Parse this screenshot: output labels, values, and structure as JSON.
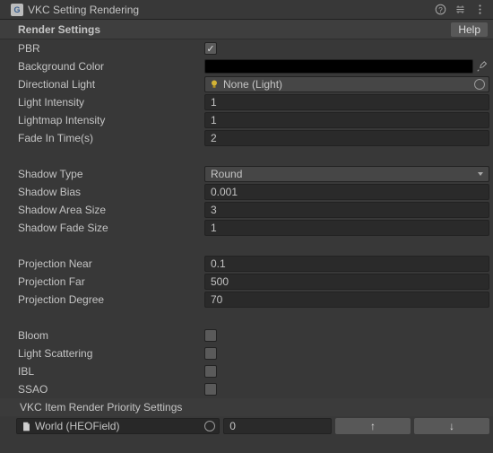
{
  "titlebar": {
    "title": "VKC Setting Rendering"
  },
  "header": {
    "title": "Render Settings",
    "help_label": "Help"
  },
  "fields": {
    "pbr": "PBR",
    "background_color": "Background Color",
    "directional_light": "Directional Light",
    "directional_light_value": "None (Light)",
    "light_intensity": "Light Intensity",
    "light_intensity_value": "1",
    "lightmap_intensity": "Lightmap Intensity",
    "lightmap_intensity_value": "1",
    "fade_in_time": "Fade In Time(s)",
    "fade_in_time_value": "2",
    "shadow_type": "Shadow Type",
    "shadow_type_value": "Round",
    "shadow_bias": "Shadow Bias",
    "shadow_bias_value": "0.001",
    "shadow_area_size": "Shadow Area Size",
    "shadow_area_size_value": "3",
    "shadow_fade_size": "Shadow Fade Size",
    "shadow_fade_size_value": "1",
    "projection_near": "Projection Near",
    "projection_near_value": "0.1",
    "projection_far": "Projection Far",
    "projection_far_value": "500",
    "projection_degree": "Projection Degree",
    "projection_degree_value": "70",
    "bloom": "Bloom",
    "light_scattering": "Light Scattering",
    "ibl": "IBL",
    "ssao": "SSAO"
  },
  "priority": {
    "header": "VKC Item Render Priority Settings",
    "item_name": "World (HEOField)",
    "item_value": "0",
    "up_label": "↑",
    "down_label": "↓"
  }
}
